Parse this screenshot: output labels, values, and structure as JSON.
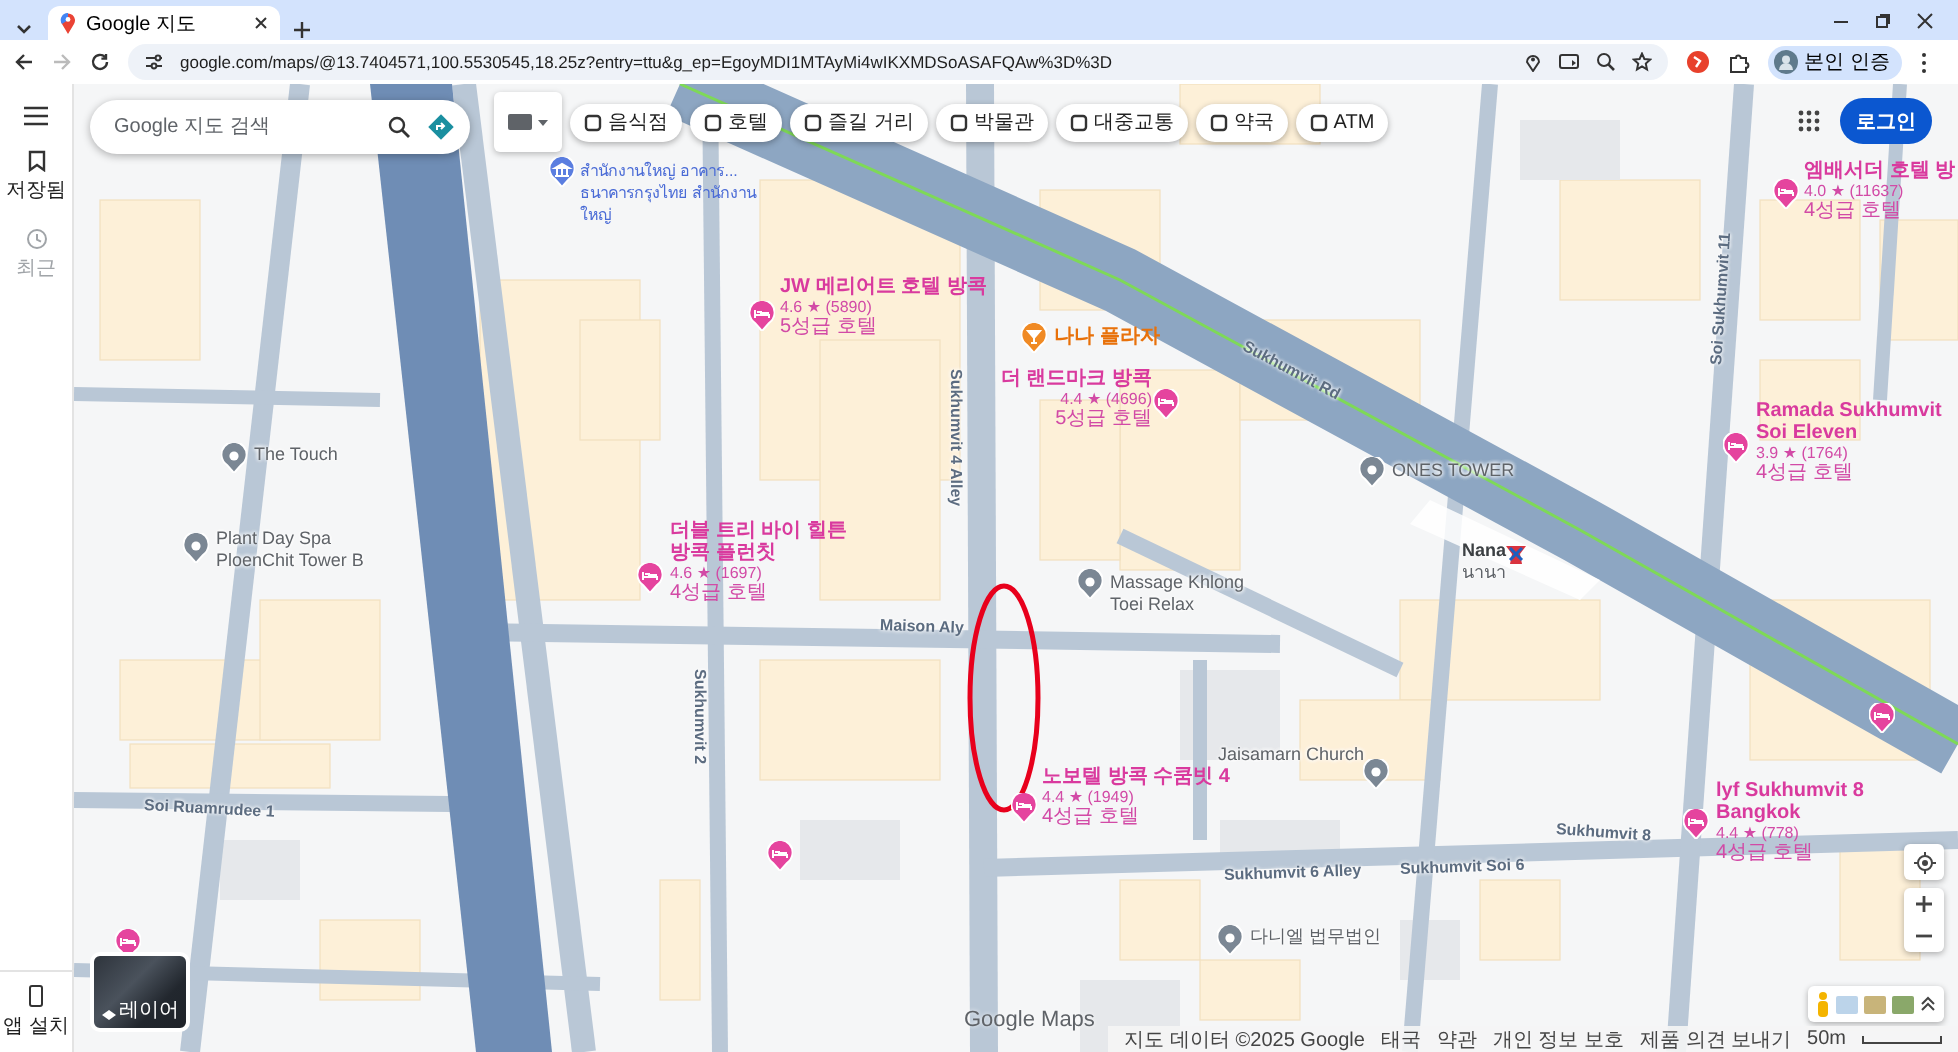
{
  "browser": {
    "tabs": [
      {
        "title": "Google 지도",
        "selected": true
      }
    ],
    "url": "google.com/maps/@13.7404571,100.5530545,18.25z?entry=ttu&g_ep=EgoyMDI1MTAyMi4wIKXMDSoASAFQAw%3D%3D",
    "profile": "본인 인증"
  },
  "sidebar": {
    "items": [
      {
        "label": "저장됨",
        "disabled": false
      },
      {
        "label": "최근",
        "disabled": true
      }
    ],
    "install": "앱 설치"
  },
  "search": {
    "placeholder": "Google 지도 검색"
  },
  "chips": [
    {
      "label": "음식점"
    },
    {
      "label": "호텔"
    },
    {
      "label": "즐길 거리"
    },
    {
      "label": "박물관"
    },
    {
      "label": "대중교통"
    },
    {
      "label": "약국"
    },
    {
      "label": "ATM"
    }
  ],
  "login": "로그인",
  "places": [
    {
      "kind": "bank",
      "name": "สำนักงานใหญ่ อาคาร...",
      "sub": "ธนาคารกรุงไทย สำนักงานใหญ่"
    },
    {
      "kind": "hotel",
      "name": "엠배서더 호텔 방",
      "rating": "4.0 ★ (11637)",
      "class": "4성급 호텔"
    },
    {
      "kind": "hotel",
      "name": "JW 메리어트 호텔 방콕",
      "rating": "4.6 ★ (5890)",
      "class": "5성급 호텔"
    },
    {
      "kind": "bar",
      "name": "나나 플라자"
    },
    {
      "kind": "hotel",
      "name": "더 랜드마크 방콕",
      "rating": "4.4 ★ (4696)",
      "class": "5성급 호텔"
    },
    {
      "kind": "hotel",
      "name": "Ramada Sukhumvit Soi Eleven",
      "rating": "3.9 ★ (1764)",
      "class": "4성급 호텔"
    },
    {
      "kind": "poi",
      "name": "The Touch"
    },
    {
      "kind": "poi",
      "name": "ONES TOWER"
    },
    {
      "kind": "poi",
      "name": "Plant Day Spa PloenChit Tower B"
    },
    {
      "kind": "hotel",
      "name": "더블 트리 바이 힐튼 방콕 플런칫",
      "rating": "4.6 ★ (1697)",
      "class": "4성급 호텔"
    },
    {
      "kind": "station",
      "name": "Nana",
      "sub": "นานา"
    },
    {
      "kind": "poi",
      "name": "Massage Khlong Toei Relax"
    },
    {
      "kind": "poi",
      "name": "Jaisamarn Church"
    },
    {
      "kind": "hotel",
      "name": "노보텔 방콕 수쿰빗 4",
      "rating": "4.4 ★ (1949)",
      "class": "4성급 호텔"
    },
    {
      "kind": "hotel",
      "name": "lyf Sukhumvit 8 Bangkok",
      "rating": "4.4 ★ (778)",
      "class": "4성급 호텔"
    },
    {
      "kind": "poi",
      "name": "다니엘 법무법인"
    }
  ],
  "roads": [
    {
      "name": "Sukhumvit Rd"
    },
    {
      "name": "Sukhumvit 4 Alley"
    },
    {
      "name": "Maison Aly"
    },
    {
      "name": "Soi Ruamrudee 1"
    },
    {
      "name": "Sukhumvit 6 Alley"
    },
    {
      "name": "Sukhumvit Soi 6"
    },
    {
      "name": "Sukhumvit 8"
    },
    {
      "name": "Soi Sukhumvit 11"
    },
    {
      "name": "Sukhumvit 2"
    }
  ],
  "layers": "레이어",
  "logo": "Google Maps",
  "footer": [
    "지도 데이터 ©2025 Google",
    "태국",
    "약관",
    "개인 정보 보호",
    "제품 의견 보내기"
  ],
  "scale": "50m"
}
